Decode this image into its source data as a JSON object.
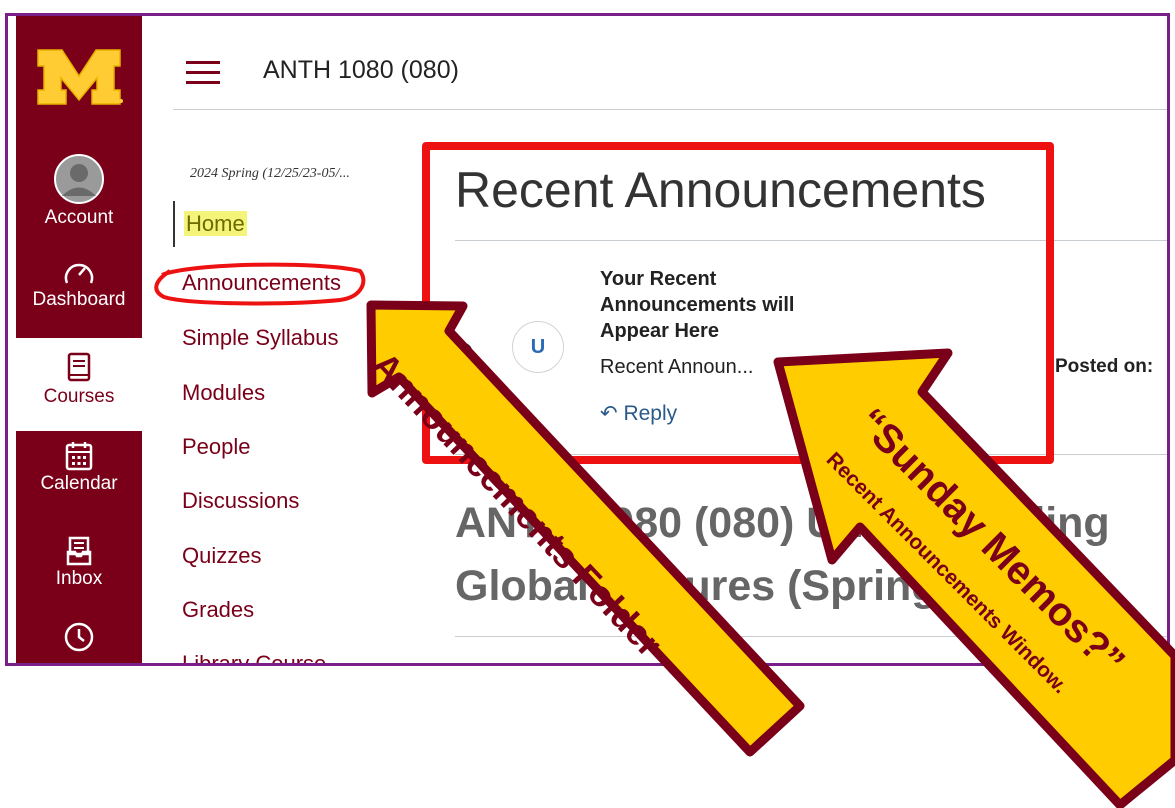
{
  "global_nav": {
    "items": [
      {
        "label": "Account",
        "icon": "account-avatar-icon"
      },
      {
        "label": "Dashboard",
        "icon": "dashboard-gauge-icon"
      },
      {
        "label": "Courses",
        "icon": "book-icon"
      },
      {
        "label": "Calendar",
        "icon": "calendar-icon"
      },
      {
        "label": "Inbox",
        "icon": "inbox-icon"
      },
      {
        "label": "",
        "icon": "clock-icon"
      }
    ],
    "brand_color": "#7a0019",
    "logo_accent": "#ffcc33"
  },
  "header": {
    "course_title": "ANTH 1080 (080)"
  },
  "course_nav": {
    "term": "2024 Spring (12/25/23-05/...",
    "items": [
      "Home",
      "Announcements",
      "Simple Syllabus",
      "Modules",
      "People",
      "Discussions",
      "Quizzes",
      "Grades",
      "Library Course"
    ]
  },
  "main": {
    "recent_title": "Recent Announcements",
    "announcement": {
      "avatar_initial": "U",
      "title": "Your Recent Announcements will Appear Here",
      "snippet": "Recent Announ...",
      "reply_label": "Reply",
      "posted_label": "Posted on:"
    },
    "course_heading_line1": "ANTH 1080 (080) Understanding",
    "course_heading_line2": "Global Cultures (Spring 2024)"
  },
  "callouts": {
    "left_arrow": "Announcements Folder",
    "right_arrow_main": "“Sunday Memos?”",
    "right_arrow_sub": "Recent Announcements Window.",
    "highlight_color": "#ee1111",
    "arrow_fill": "#ffcc00",
    "arrow_outline": "#7a0019"
  }
}
